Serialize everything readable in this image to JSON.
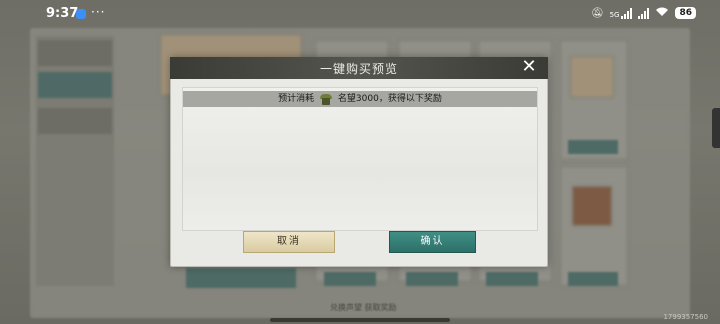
{
  "status_bar": {
    "time": "9:37",
    "dots": "···",
    "network": "5G",
    "battery": "86"
  },
  "background": {
    "bottom_text": "兑换声望 获取奖励",
    "build_id": "1799357560"
  },
  "dialog": {
    "title": "一键购买预览",
    "close_icon": "close-icon",
    "cost_prefix": "预计消耗",
    "cost_icon": "fame-icon",
    "cost_suffix": "名望3000，获得以下奖励",
    "cancel_label": "取消",
    "confirm_label": "确认"
  },
  "colors": {
    "title_bar": "#45453f",
    "confirm_button": "#34807a",
    "cancel_button": "#e3d7b2"
  }
}
